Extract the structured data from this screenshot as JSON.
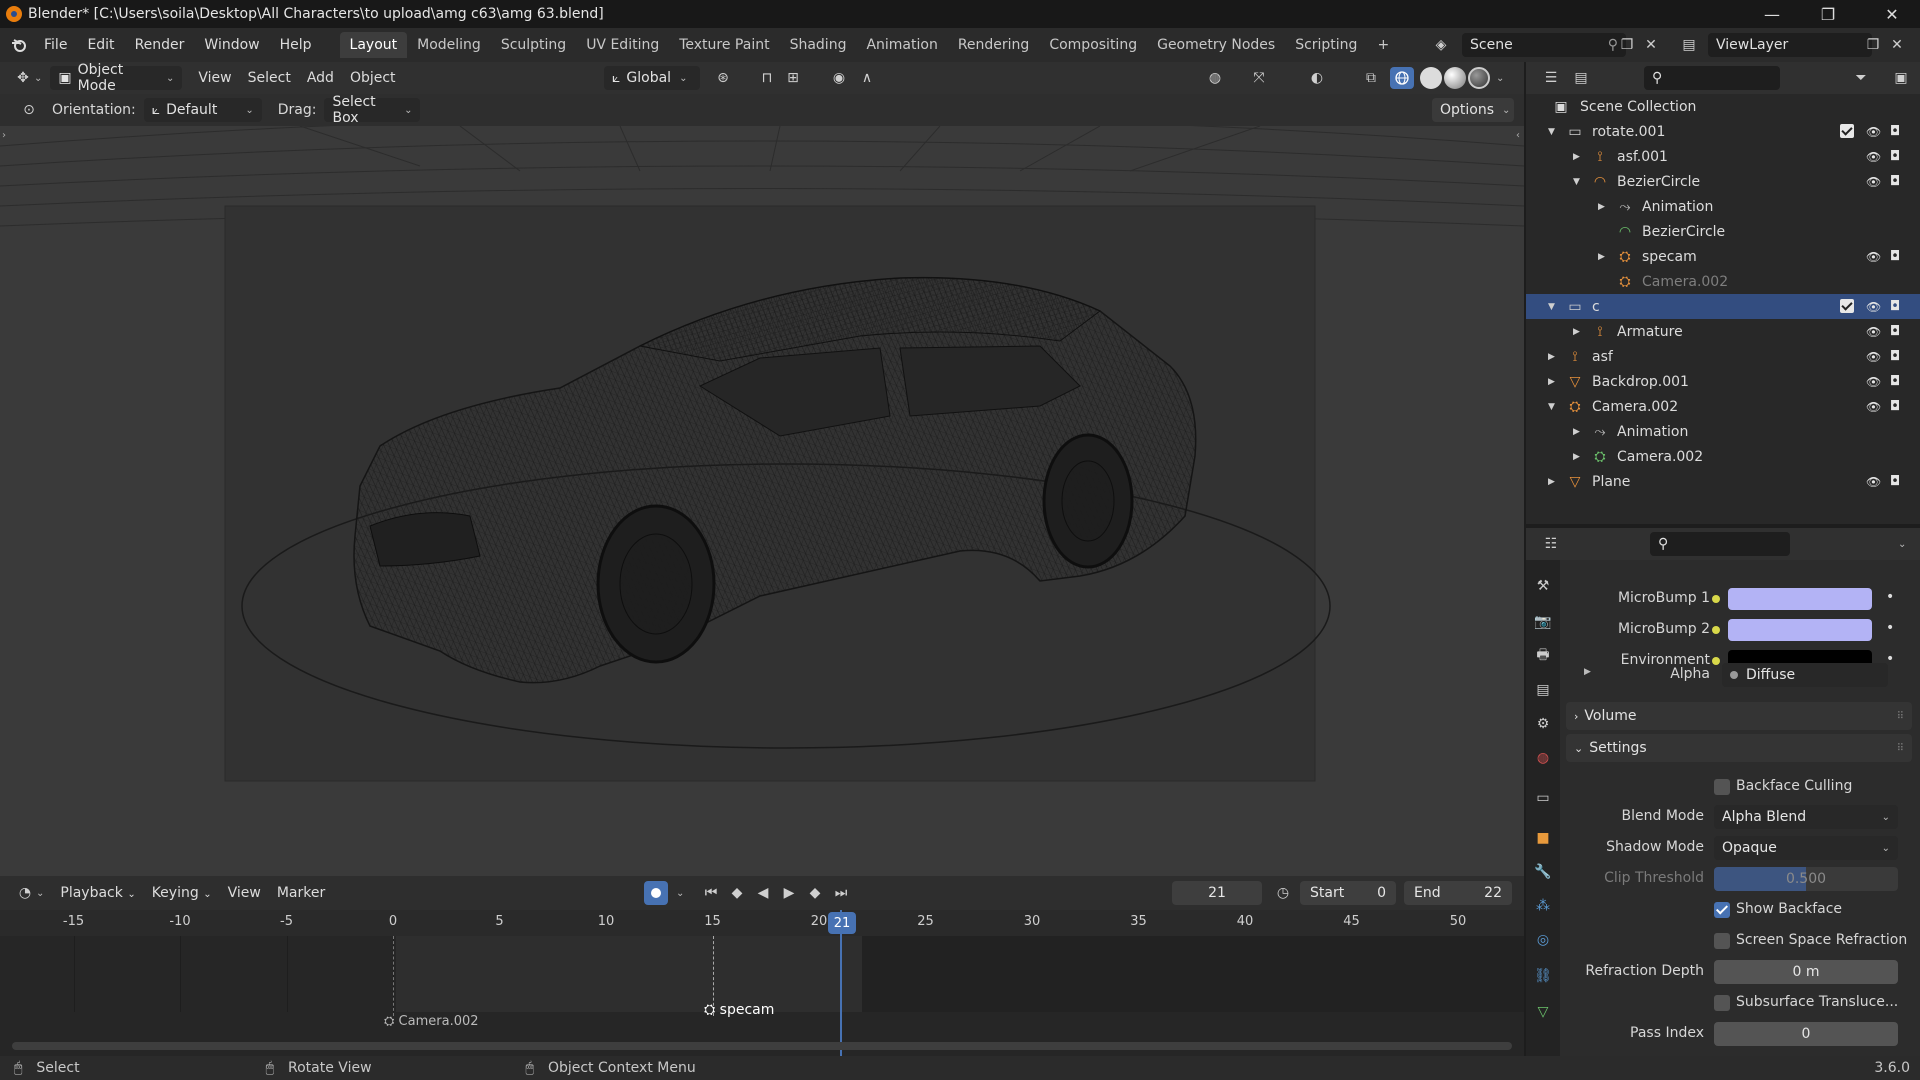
{
  "window": {
    "title": "Blender* [C:\\Users\\soila\\Desktop\\All Characters\\to upload\\amg c63\\amg 63.blend]"
  },
  "menu": [
    "File",
    "Edit",
    "Render",
    "Window",
    "Help"
  ],
  "workspaces": [
    "Layout",
    "Modeling",
    "Sculpting",
    "UV Editing",
    "Texture Paint",
    "Shading",
    "Animation",
    "Rendering",
    "Compositing",
    "Geometry Nodes",
    "Scripting"
  ],
  "active_workspace": "Layout",
  "scene_field": "Scene",
  "viewlayer_field": "ViewLayer",
  "viewport_header": {
    "mode": "Object Mode",
    "menus": [
      "View",
      "Select",
      "Add",
      "Object"
    ],
    "transform": "Global"
  },
  "tool_settings": {
    "orientation_label": "Orientation:",
    "orientation_value": "Default",
    "drag_label": "Drag:",
    "drag_value": "Select Box",
    "options": "Options"
  },
  "timeline": {
    "menus": [
      "Playback",
      "Keying",
      "View",
      "Marker"
    ],
    "current_frame": "21",
    "start_label": "Start",
    "start": "0",
    "end_label": "End",
    "end": "22",
    "ticks": [
      "-15",
      "-10",
      "-5",
      "0",
      "5",
      "10",
      "15",
      "20",
      "25",
      "30",
      "35",
      "40",
      "45",
      "50"
    ],
    "markers": [
      {
        "label": "Camera.002"
      },
      {
        "label": "specam"
      }
    ],
    "playhead_label": "21"
  },
  "outliner": {
    "root": "Scene Collection",
    "rows": [
      {
        "label": "rotate.001",
        "indent": 0,
        "arrow": "down",
        "icon": "collection-icon"
      },
      {
        "label": "asf.001",
        "indent": 1,
        "arrow": "right",
        "icon": "armature-icon"
      },
      {
        "label": "BezierCircle",
        "indent": 1,
        "arrow": "down",
        "icon": "curve-icon"
      },
      {
        "label": "Animation",
        "indent": 2,
        "arrow": "right",
        "icon": "action-icon"
      },
      {
        "label": "BezierCircle",
        "indent": 2,
        "arrow": "",
        "icon": "curve-data-icon"
      },
      {
        "label": "specam",
        "indent": 2,
        "arrow": "right",
        "icon": "camera-icon"
      },
      {
        "label": "Camera.002",
        "indent": 2,
        "arrow": "",
        "icon": "camera-icon"
      },
      {
        "label": "c",
        "indent": 0,
        "arrow": "down",
        "icon": "collection-icon"
      },
      {
        "label": "Armature",
        "indent": 1,
        "arrow": "right",
        "icon": "armature-icon"
      },
      {
        "label": "asf",
        "indent": 0,
        "arrow": "right",
        "icon": "armature-icon"
      },
      {
        "label": "Backdrop.001",
        "indent": 0,
        "arrow": "right",
        "icon": "mesh-icon"
      },
      {
        "label": "Camera.002",
        "indent": 0,
        "arrow": "down",
        "icon": "camera-icon"
      },
      {
        "label": "Animation",
        "indent": 1,
        "arrow": "right",
        "icon": "action-icon"
      },
      {
        "label": "Camera.002",
        "indent": 1,
        "arrow": "right",
        "icon": "camera-data-icon"
      },
      {
        "label": "Plane",
        "indent": 0,
        "arrow": "right",
        "icon": "mesh-icon"
      }
    ]
  },
  "properties": {
    "color_inputs": [
      {
        "label": "MicroBump 1",
        "color": "#b3b3f5"
      },
      {
        "label": "MicroBump 2",
        "color": "#b3b3f5"
      },
      {
        "label": "Environment",
        "color": "#000000"
      }
    ],
    "alpha_label": "Alpha",
    "alpha_value": "Diffuse",
    "volume_section": "Volume",
    "settings_section": "Settings",
    "backface_culling": "Backface Culling",
    "blend_mode_label": "Blend Mode",
    "blend_mode_value": "Alpha Blend",
    "shadow_mode_label": "Shadow Mode",
    "shadow_mode_value": "Opaque",
    "clip_threshold_label": "Clip Threshold",
    "clip_threshold_value": "0.500",
    "show_backface": "Show Backface",
    "screen_space_refraction": "Screen Space Refraction",
    "refraction_depth_label": "Refraction Depth",
    "refraction_depth_value": "0 m",
    "subsurface_translucency": "Subsurface Translucе...",
    "pass_index_label": "Pass Index",
    "pass_index_value": "0"
  },
  "statusbar": {
    "select": "Select",
    "rotate": "Rotate View",
    "context": "Object Context Menu",
    "version": "3.6.0"
  },
  "colors": {
    "accent": "#4772b3",
    "selection": "#334d80",
    "playhead": "#4772b3"
  }
}
